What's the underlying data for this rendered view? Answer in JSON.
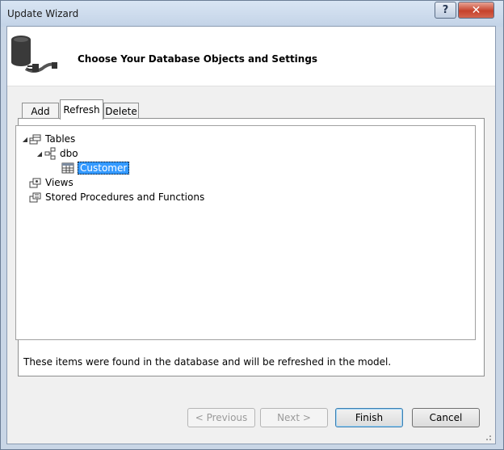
{
  "window": {
    "title": "Update Wizard",
    "help_label": "?",
    "close_label": "✕"
  },
  "header": {
    "title": "Choose Your Database Objects and Settings"
  },
  "tabs": [
    {
      "label": "Add"
    },
    {
      "label": "Refresh"
    },
    {
      "label": "Delete"
    }
  ],
  "tree": {
    "tables": "Tables",
    "schema": "dbo",
    "table_item": "Customer",
    "views": "Views",
    "procs": "Stored Procedures and Functions"
  },
  "info": "These items were found in the database and will be refreshed in the model.",
  "buttons": {
    "previous": "< Previous",
    "next": "Next >",
    "finish": "Finish",
    "cancel": "Cancel"
  },
  "colors": {
    "selection": "#3399ff",
    "close": "#c6422c"
  }
}
